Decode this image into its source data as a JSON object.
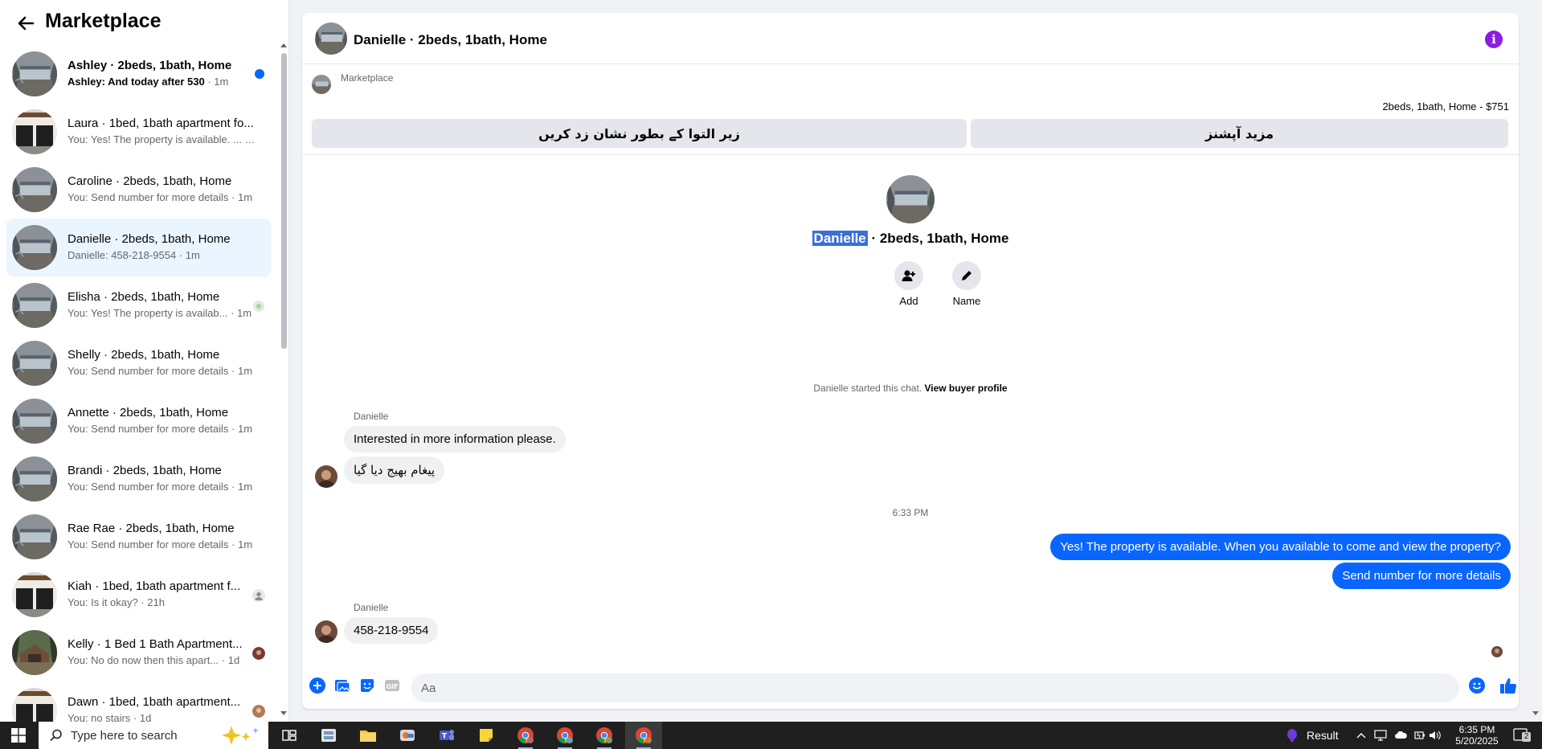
{
  "sidebar": {
    "title": "Marketplace",
    "conversations": [
      {
        "title": "Ashley · 2beds, 1bath, Home",
        "preview": "Ashley: And today after 530",
        "time": " · 1m",
        "unread": true,
        "thumb": "house"
      },
      {
        "title": "Laura · 1bed, 1bath apartment fo...",
        "preview": "You: Yes! The property is available. ...",
        "time": " · 1m",
        "unread": false,
        "thumb": "garage"
      },
      {
        "title": "Caroline · 2beds, 1bath, Home",
        "preview": "You: Send number for more details",
        "time": " · 1m",
        "unread": false,
        "thumb": "house"
      },
      {
        "title": "Danielle · 2beds, 1bath, Home",
        "preview": "Danielle: 458-218-9554",
        "time": " · 1m",
        "unread": false,
        "active": true,
        "thumb": "house"
      },
      {
        "title": "Elisha · 2beds, 1bath, Home",
        "preview": "You: Yes! The property is availab...",
        "time": " · 1m",
        "unread": false,
        "thumb": "house"
      },
      {
        "title": "Shelly · 2beds, 1bath, Home",
        "preview": "You: Send number for more details",
        "time": " · 1m",
        "unread": false,
        "thumb": "house"
      },
      {
        "title": "Annette · 2beds, 1bath, Home",
        "preview": "You: Send number for more details",
        "time": " · 1m",
        "unread": false,
        "thumb": "house"
      },
      {
        "title": "Brandi · 2beds, 1bath, Home",
        "preview": "You: Send number for more details",
        "time": " · 1m",
        "unread": false,
        "thumb": "house"
      },
      {
        "title": "Rae Rae · 2beds, 1bath, Home",
        "preview": "You: Send number for more details",
        "time": " · 1m",
        "unread": false,
        "thumb": "house"
      },
      {
        "title": "Kiah · 1bed, 1bath apartment f...",
        "preview": "You: Is it okay?",
        "time": " · 21h",
        "unread": false,
        "thumb": "garage"
      },
      {
        "title": "Kelly · 1 Bed 1 Bath Apartment...",
        "preview": "You: No do now then this apart...",
        "time": " · 1d",
        "unread": false,
        "thumb": "cabin"
      },
      {
        "title": "Dawn · 1bed, 1bath apartment...",
        "preview": "You: no stairs",
        "time": " · 1d",
        "unread": false,
        "thumb": "garage"
      }
    ]
  },
  "chat": {
    "header_name": "Danielle · 2beds, 1bath, Home",
    "marketplace_label": "Marketplace",
    "listing": "2beds, 1bath, Home - $751",
    "btn_mark_pending": "زیر التوا کے بطور نشان زد کریں",
    "btn_more_options": "مزید آپشنز",
    "profile_name_highlight": "Danielle",
    "profile_name_rest": " · 2beds, 1bath, Home",
    "action_add": "Add",
    "action_name": "Name",
    "started_text": "Danielle started this chat. ",
    "view_buyer_profile": "View buyer profile",
    "messages": {
      "sender1": "Danielle",
      "in1": "Interested in more information please.",
      "in2": "پیغام بھیج دیا گیا",
      "timestamp": "6:33 PM",
      "out1": "Yes! The property is available. When you available to come and view the property?",
      "out2": "Send number for more details",
      "sender2": "Danielle",
      "in3": "458-218-9554"
    },
    "composer_placeholder": "Aa"
  },
  "taskbar": {
    "search_placeholder": "Type here to search",
    "result_label": "Result",
    "time": "6:35 PM",
    "date": "5/20/2025",
    "notification_count": "2"
  },
  "colors": {
    "accent": "#0866ff",
    "info": "#8a1ee0",
    "active_row": "#ebf5ff"
  }
}
